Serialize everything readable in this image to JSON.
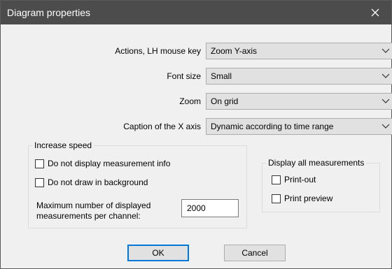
{
  "window": {
    "title": "Diagram properties"
  },
  "fields": [
    {
      "label": "Actions, LH mouse key",
      "value": "Zoom Y-axis"
    },
    {
      "label": "Font size",
      "value": "Small"
    },
    {
      "label": "Zoom",
      "value": "On grid"
    },
    {
      "label": "Caption of the X axis",
      "value": "Dynamic according to time range"
    }
  ],
  "increase_speed": {
    "legend": "Increase speed",
    "checkboxes": [
      {
        "label": "Do not display measurement info",
        "checked": false
      },
      {
        "label": "Do not draw in background",
        "checked": false
      }
    ],
    "max_label_line1": "Maximum number of displayed",
    "max_label_line2": "measurements per channel:",
    "max_value": "2000"
  },
  "display_all": {
    "legend": "Display all measurements",
    "checkboxes": [
      {
        "label": "Print-out",
        "checked": false
      },
      {
        "label": "Print preview",
        "checked": false
      }
    ]
  },
  "buttons": {
    "ok": "OK",
    "cancel": "Cancel"
  }
}
